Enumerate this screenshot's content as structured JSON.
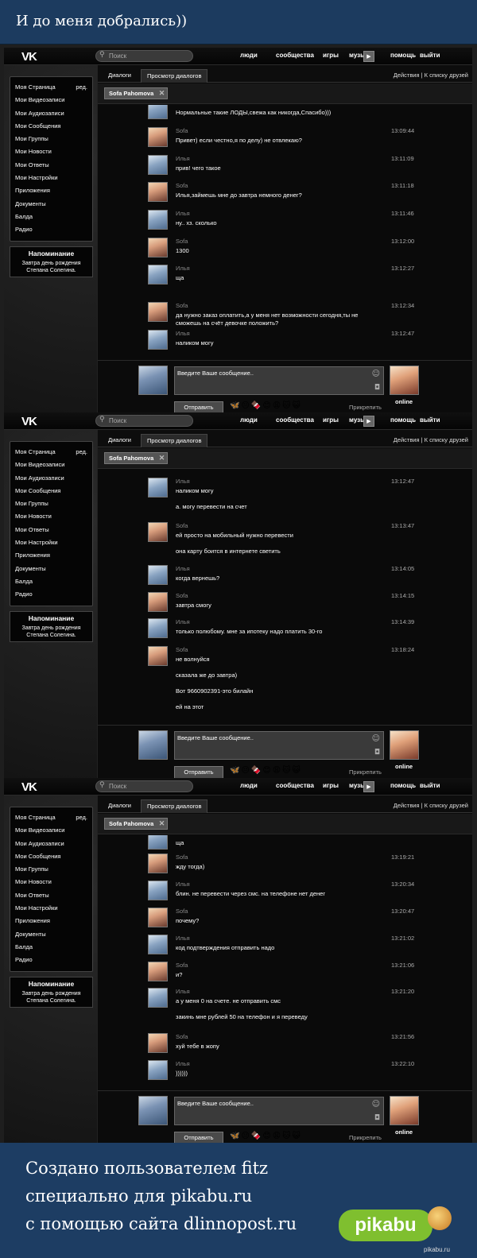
{
  "banner": {
    "title": "И до меня добрались))"
  },
  "vk": {
    "logo": "VK",
    "search_placeholder": "Поиск",
    "nav": [
      "люди",
      "сообщества",
      "игры",
      "музыка",
      "помощь",
      "выйти"
    ],
    "sidebar": [
      "Моя Страница",
      "Мои Видеозаписи",
      "Мои Аудиозаписи",
      "Мои Сообщения",
      "Мои Группы",
      "Мои Новости",
      "Мои Ответы",
      "Мои Настройки",
      "Приложения",
      "Документы",
      "Балда",
      "Радио"
    ],
    "edit": "ред.",
    "reminder_title": "Напоминание",
    "reminder_text": "Завтра день рождения Степана Солегина.",
    "tab_dialogs": "Диалоги",
    "tab_view": "Просмотр диалогов",
    "actions": "Действия  |  К списку друзей",
    "peer": "Sofa Pahomova",
    "composer_placeholder": "Введите Ваше сообщение..",
    "send": "Отправить",
    "attach": "Прикрепить",
    "online": "online",
    "emoji": "🦋😐🍫😊😩🐱😺"
  },
  "screens": [
    {
      "messages": [
        {
          "name": "",
          "time": "",
          "lines": [
            "Нормальные такие ЛОДЫ,свежа как никогда,Спасибо)))"
          ]
        },
        {
          "name": "Sofa",
          "time": "13:09:44",
          "lines": [
            "Привет) если честно,я по делу) не отвлекаю?"
          ]
        },
        {
          "name": "Илья",
          "time": "13:11:09",
          "lines": [
            "прив! чего такое"
          ]
        },
        {
          "name": "Sofa",
          "time": "13:11:18",
          "lines": [
            "Илья,займешь мне до завтра немного денег?"
          ]
        },
        {
          "name": "Илья",
          "time": "13:11:46",
          "lines": [
            "ну.. хз. сколько"
          ]
        },
        {
          "name": "Sofa",
          "time": "13:12:00",
          "lines": [
            "1300"
          ]
        },
        {
          "name": "Илья",
          "time": "13:12:27",
          "lines": [
            "ща"
          ]
        },
        {
          "name": "Sofa",
          "time": "13:12:34",
          "lines": [
            "да нужно заказ оплатить,а у меня нет возможности сегодня,ты не",
            "сможешь на счёт девочке положить?"
          ]
        },
        {
          "name": "Илья",
          "time": "13:12:47",
          "lines": [
            "наликом могу"
          ]
        }
      ]
    },
    {
      "messages": [
        {
          "name": "Илья",
          "time": "13:12:47",
          "lines": [
            "наликом могу",
            "",
            "а. могу перевести на счет"
          ]
        },
        {
          "name": "Sofa",
          "time": "13:13:47",
          "lines": [
            "ей просто на мобильный нужно перевести",
            "",
            "она карту боится в интернете светить"
          ]
        },
        {
          "name": "Илья",
          "time": "13:14:05",
          "lines": [
            "когда вернешь?"
          ]
        },
        {
          "name": "Sofa",
          "time": "13:14:15",
          "lines": [
            "завтра смогу"
          ]
        },
        {
          "name": "Илья",
          "time": "13:14:39",
          "lines": [
            "только полюбому. мне за ипотеку надо платить 30-го"
          ]
        },
        {
          "name": "Sofa",
          "time": "13:18:24",
          "lines": [
            "не волнуйся",
            "",
            "сказала же до завтра)",
            "",
            "Вот 9660902391-это билайн",
            "",
            "ей на этот"
          ]
        }
      ]
    },
    {
      "messages": [
        {
          "name": "",
          "time": "",
          "lines": [
            "ща"
          ]
        },
        {
          "name": "Sofa",
          "time": "13:19:21",
          "lines": [
            "жду тогда)"
          ]
        },
        {
          "name": "Илья",
          "time": "13:20:34",
          "lines": [
            "блин. не перевести через смс. на телефоне нет денег"
          ]
        },
        {
          "name": "Sofa",
          "time": "13:20:47",
          "lines": [
            "почему?"
          ]
        },
        {
          "name": "Илья",
          "time": "13:21:02",
          "lines": [
            "код подтверждения отправить надо"
          ]
        },
        {
          "name": "Sofa",
          "time": "13:21:06",
          "lines": [
            "и?"
          ]
        },
        {
          "name": "Илья",
          "time": "13:21:20",
          "lines": [
            "а у меня 0 на счете. не отправить смс",
            "",
            "закинь мне рублей 50 на телефон и я переведу"
          ]
        },
        {
          "name": "Sofa",
          "time": "13:21:56",
          "lines": [
            "хуй тебе в жопу"
          ]
        },
        {
          "name": "Илья",
          "time": "13:22:10",
          "lines": [
            "))))))"
          ]
        }
      ]
    }
  ],
  "footer": {
    "lines": [
      "Создано пользователем fitz",
      "специально для pikabu.ru",
      "с помощью сайта dlinnopost.ru"
    ],
    "logo": "pikabu",
    "watermark": "pikabu.ru"
  }
}
